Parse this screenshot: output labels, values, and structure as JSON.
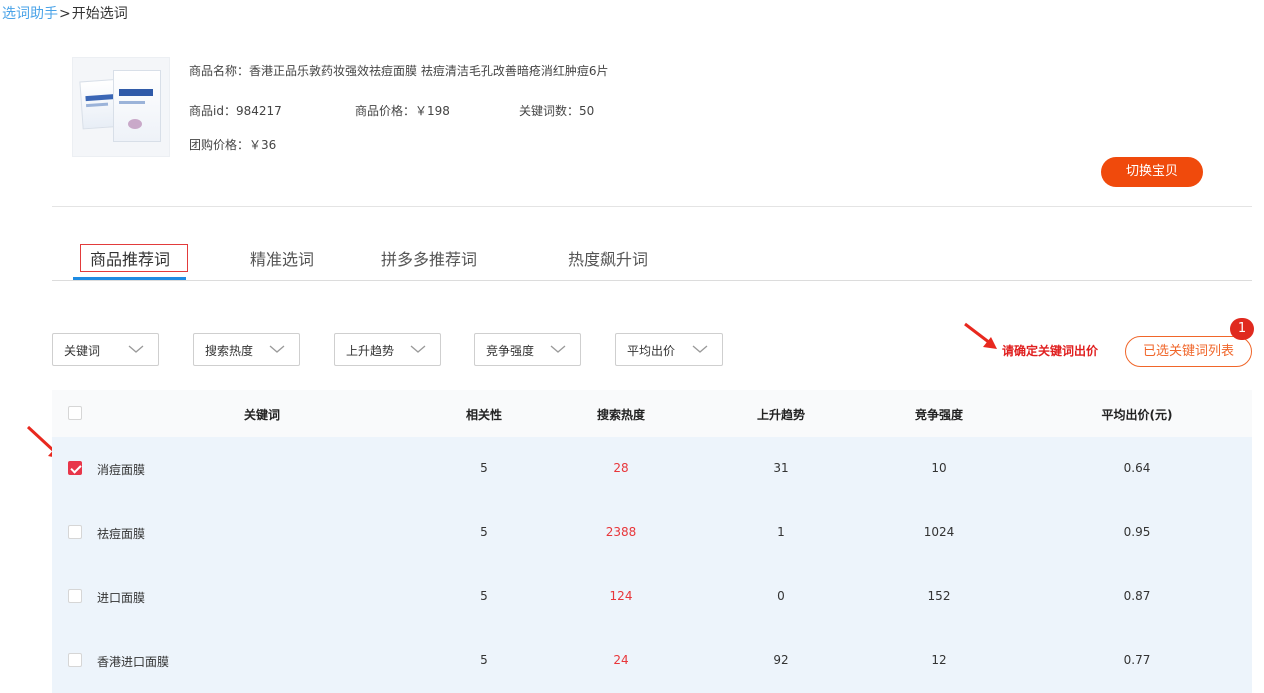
{
  "breadcrumb": {
    "link": "选词助手",
    "separator": ">",
    "current": "开始选词"
  },
  "product": {
    "name_line": "商品名称：香港正品乐敦药妆强效祛痘面膜 祛痘清洁毛孔改善暗疮消红肿痘6片",
    "id_line": "商品id：984217",
    "price_line": "商品价格：￥198",
    "keyword_count_line": "关键词数：50",
    "group_price_line": "团购价格：￥36",
    "switch_button": "切换宝贝"
  },
  "tabs": [
    {
      "label": "商品推荐词",
      "active": true
    },
    {
      "label": "精准选词",
      "active": false
    },
    {
      "label": "拼多多推荐词",
      "active": false
    },
    {
      "label": "热度飙升词",
      "active": false
    }
  ],
  "filters": [
    "关键词",
    "搜索热度",
    "上升趋势",
    "竞争强度",
    "平均出价"
  ],
  "hint": {
    "text": "请确定关键词出价"
  },
  "selected_list": {
    "label": "已选关键词列表",
    "badge": "1"
  },
  "table": {
    "headers": [
      "关键词",
      "相关性",
      "搜索热度",
      "上升趋势",
      "竞争强度",
      "平均出价(元)"
    ],
    "rows": [
      {
        "checked": true,
        "keyword": "消痘面膜",
        "relevance": "5",
        "heat": "28",
        "trend": "31",
        "competition": "10",
        "avg_bid": "0.64"
      },
      {
        "checked": false,
        "keyword": "祛痘面膜",
        "relevance": "5",
        "heat": "2388",
        "trend": "1",
        "competition": "1024",
        "avg_bid": "0.95"
      },
      {
        "checked": false,
        "keyword": "进口面膜",
        "relevance": "5",
        "heat": "124",
        "trend": "0",
        "competition": "152",
        "avg_bid": "0.87"
      },
      {
        "checked": false,
        "keyword": "香港进口面膜",
        "relevance": "5",
        "heat": "24",
        "trend": "92",
        "competition": "12",
        "avg_bid": "0.77"
      }
    ]
  },
  "colors": {
    "accent_blue": "#1e8be2",
    "switch_orange": "#f04a0c",
    "hint_red": "#e02020",
    "hot_red": "#e8363a",
    "row_bg": "#edf4fb"
  }
}
